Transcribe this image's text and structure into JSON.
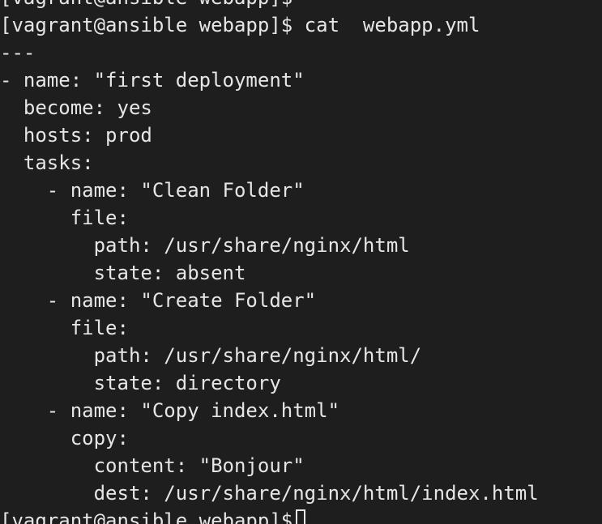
{
  "terminal": {
    "lines": [
      "[vagrant@ansible webapp]$",
      "[vagrant@ansible webapp]$ cat  webapp.yml",
      "---",
      "- name: \"first deployment\"",
      "  become: yes",
      "  hosts: prod",
      "  tasks:",
      "    - name: \"Clean Folder\"",
      "      file:",
      "        path: /usr/share/nginx/html",
      "        state: absent",
      "    - name: \"Create Folder\"",
      "      file:",
      "        path: /usr/share/nginx/html/",
      "        state: directory",
      "    - name: \"Copy index.html\"",
      "      copy:",
      "        content: \"Bonjour\"",
      "        dest: /usr/share/nginx/html/index.html"
    ],
    "prompt": "[vagrant@ansible webapp]$"
  },
  "colors": {
    "background": "#1e1e1e",
    "foreground": "#e6e6e6"
  }
}
